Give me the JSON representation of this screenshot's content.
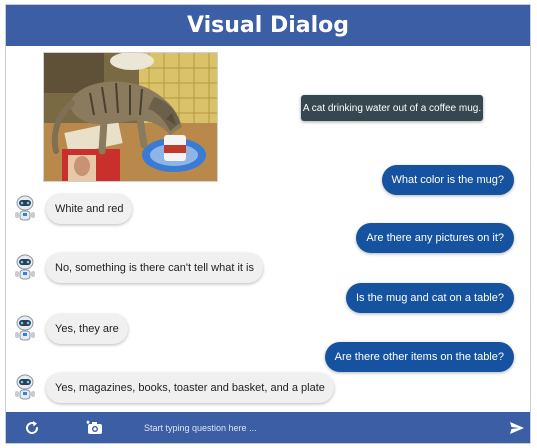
{
  "app": {
    "title": "Visual Dialog"
  },
  "caption": "A cat drinking water out of a coffee mug.",
  "dialog": [
    {
      "question": "What color is the mug?",
      "answer": "White and red"
    },
    {
      "question": "Are there any pictures on it?",
      "answer": "No, something is there can't tell what it is"
    },
    {
      "question": "Is the mug and cat on a table?",
      "answer": "Yes, they are"
    },
    {
      "question": "Are there other items on the table?",
      "answer": "Yes, magazines, books, toaster and basket, and a plate"
    }
  ],
  "footer": {
    "placeholder": "Start typing question here ..."
  },
  "colors": {
    "header": "#3b5ea4",
    "question_bubble": "#1553a0",
    "answer_bubble": "#f0f0f0",
    "caption_bg": "#37474f"
  },
  "icons": {
    "reset": "refresh-icon",
    "upload": "camera-plus-icon",
    "send": "send-icon",
    "avatar": "robot-icon"
  }
}
